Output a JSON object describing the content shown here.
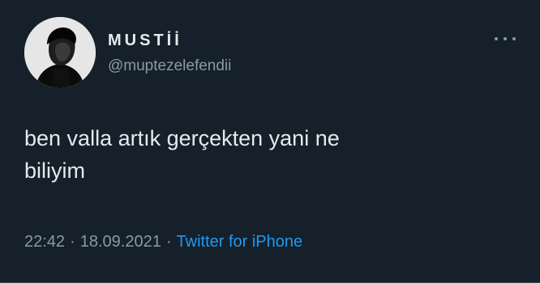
{
  "tweet": {
    "author": {
      "display_name": "MUSTİİ",
      "handle": "@muptezelefendii",
      "avatar_icon": "profile-photo"
    },
    "text": "ben valla artık gerçekten yani ne\nbiliyim",
    "time": "22:42",
    "separator": "·",
    "date": "18.09.2021",
    "source": "Twitter for iPhone",
    "more_icon": "more-horizontal-icon"
  },
  "colors": {
    "background": "#15202b",
    "primary_text": "#e7e9ea",
    "secondary_text": "#8b98a5",
    "link": "#1d9bf0"
  }
}
